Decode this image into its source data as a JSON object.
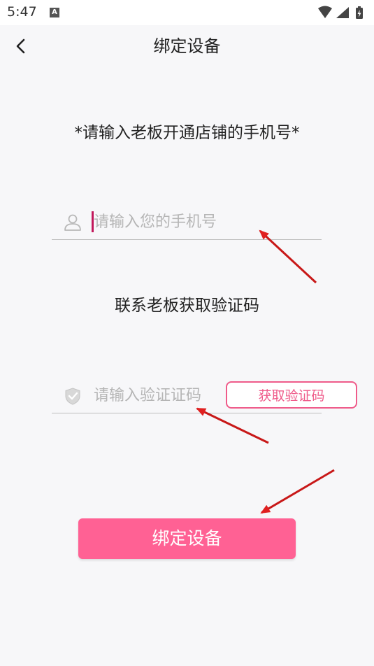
{
  "status_bar": {
    "time": "5:47",
    "notification_letter": "A"
  },
  "header": {
    "title": "绑定设备"
  },
  "instruction": "*请输入老板开通店铺的手机号*",
  "phone_field": {
    "placeholder": "请输入您的手机号",
    "value": ""
  },
  "contact_hint": "联系老板获取验证码",
  "code_field": {
    "placeholder": "请输入验证证码",
    "value": ""
  },
  "get_code_label": "获取验证码",
  "bind_button_label": "绑定设备",
  "colors": {
    "accent": "#ff6194",
    "outline": "#ef5b8a",
    "arrow": "#e02020"
  },
  "icons": [
    "back-icon",
    "user-icon",
    "shield-icon",
    "wifi-icon",
    "signal-icon",
    "battery-icon"
  ]
}
